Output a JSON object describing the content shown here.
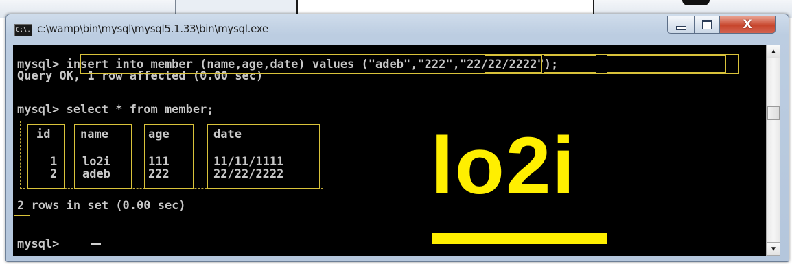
{
  "window": {
    "title": "c:\\wamp\\bin\\mysql\\mysql5.1.33\\bin\\mysql.exe",
    "app_icon_text": "C:\\."
  },
  "console": {
    "lines": [
      {
        "prompt": "mysql> ",
        "text": "insert into member (name,age,date) values ("
      },
      {
        "text": "\"adeb\""
      },
      {
        "text": ","
      },
      {
        "text": "\"222\""
      },
      {
        "text": ","
      },
      {
        "text": "\"22/22/2222\""
      },
      {
        "text": ");"
      },
      {
        "text": "Query OK, 1 row affected (0.00 sec)"
      },
      {
        "text": "mysql> select * from member;"
      },
      {
        "text": "2"
      },
      {
        "text": " rows in set (0.00 sec)"
      },
      {
        "text": "mysql> "
      }
    ],
    "table": {
      "headers": [
        "id",
        "name",
        "age",
        "date"
      ],
      "rows": [
        [
          "1",
          "lo2i",
          "111",
          "11/11/1111"
        ],
        [
          "2",
          "adeb",
          "222",
          "22/22/2222"
        ]
      ]
    }
  },
  "overlay": {
    "logo_text": "lo2i",
    "accent_color": "#ffef00",
    "highlight_color": "#d9c23a"
  },
  "icons": {
    "app": "console-icon",
    "minimize": "minimize-icon",
    "maximize": "maximize-icon",
    "close": "close-icon",
    "scroll_up": "arrow-up-icon",
    "scroll_down": "arrow-down-icon"
  }
}
